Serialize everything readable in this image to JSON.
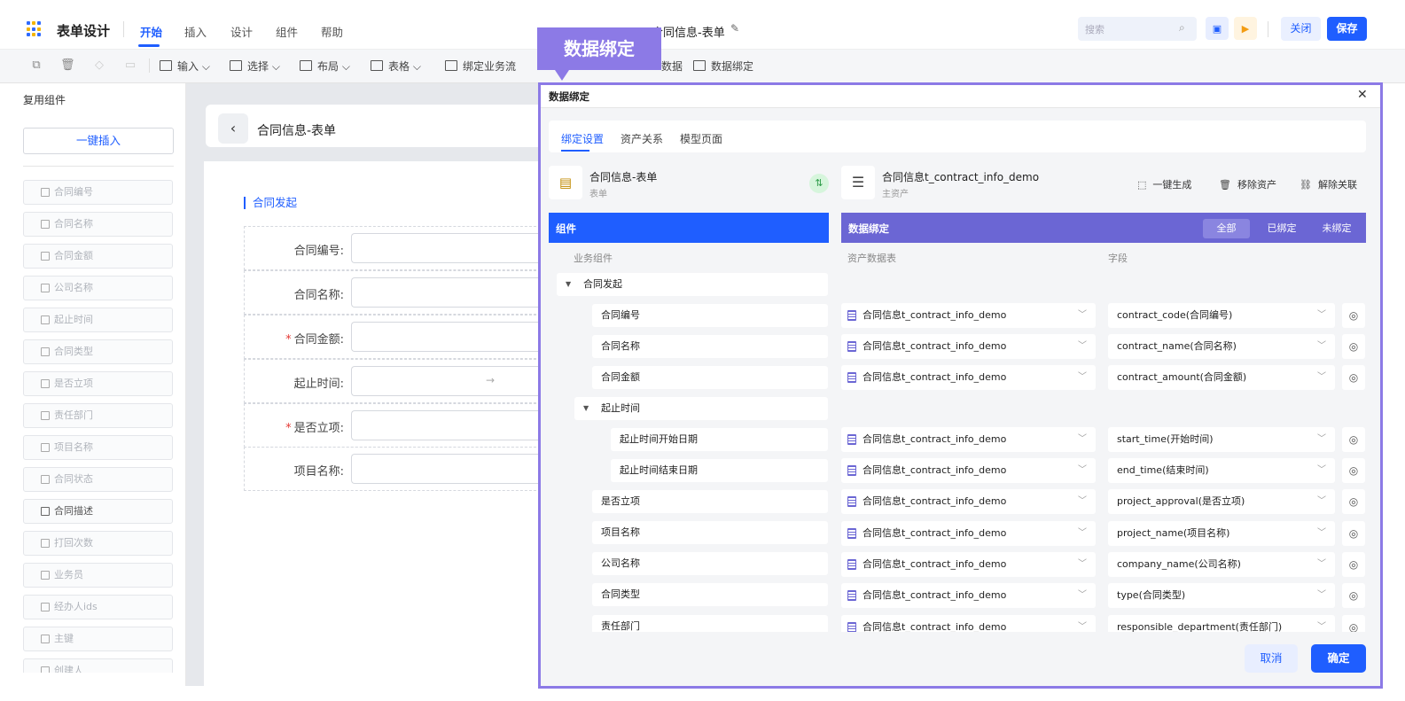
{
  "header": {
    "app_title": "表单设计",
    "menu": [
      "开始",
      "插入",
      "设计",
      "组件",
      "帮助"
    ],
    "doc_title": "合同信息-表单",
    "search_placeholder": "搜索",
    "close_label": "关闭",
    "save_label": "保存"
  },
  "toolbar": {
    "items": [
      "输入",
      "选择",
      "布局",
      "表格",
      "绑定业务流",
      "数据",
      "数据绑定"
    ]
  },
  "left_panel": {
    "title": "复用组件",
    "insert_button": "一键插入",
    "components": [
      "合同编号",
      "合同名称",
      "合同金额",
      "公司名称",
      "起止时间",
      "合同类型",
      "是否立项",
      "责任部门",
      "项目名称",
      "合同状态",
      "合同描述",
      "打回次数",
      "业务员",
      "经办人ids",
      "主键",
      "创建人"
    ]
  },
  "form": {
    "title": "合同信息-表单",
    "section": "合同发起",
    "fields": [
      {
        "label": "合同编号:",
        "required": false
      },
      {
        "label": "合同名称:",
        "required": false
      },
      {
        "label": "合同金额:",
        "required": true
      },
      {
        "label": "起止时间:",
        "required": false
      },
      {
        "label": "是否立项:",
        "required": true
      },
      {
        "label": "项目名称:",
        "required": false
      }
    ],
    "range_arrow": "→"
  },
  "callout": {
    "text": "数据绑定"
  },
  "modal": {
    "title": "数据绑定",
    "tabs": [
      "绑定设置",
      "资产关系",
      "模型页面"
    ],
    "source": {
      "name": "合同信息-表单",
      "type": "表单"
    },
    "target": {
      "name": "合同信息t_contract_info_demo",
      "type": "主资产"
    },
    "actions": [
      "一键生成",
      "移除资产",
      "解除关联"
    ],
    "left_header": "组件",
    "right_header": "数据绑定",
    "filters": [
      "全部",
      "已绑定",
      "未绑定"
    ],
    "col_business": "业务组件",
    "col_table": "资产数据表",
    "col_field": "字段",
    "group": "合同发起",
    "subgroup": "起止时间",
    "rows": [
      {
        "name": "合同编号",
        "table": "合同信息t_contract_info_demo",
        "field": "contract_code(合同编号)"
      },
      {
        "name": "合同名称",
        "table": "合同信息t_contract_info_demo",
        "field": "contract_name(合同名称)"
      },
      {
        "name": "合同金额",
        "table": "合同信息t_contract_info_demo",
        "field": "contract_amount(合同金额)"
      },
      {
        "name": "起止时间开始日期",
        "table": "合同信息t_contract_info_demo",
        "field": "start_time(开始时间)"
      },
      {
        "name": "起止时间结束日期",
        "table": "合同信息t_contract_info_demo",
        "field": "end_time(结束时间)"
      },
      {
        "name": "是否立项",
        "table": "合同信息t_contract_info_demo",
        "field": "project_approval(是否立项)"
      },
      {
        "name": "项目名称",
        "table": "合同信息t_contract_info_demo",
        "field": "project_name(项目名称)"
      },
      {
        "name": "公司名称",
        "table": "合同信息t_contract_info_demo",
        "field": "company_name(公司名称)"
      },
      {
        "name": "合同类型",
        "table": "合同信息t_contract_info_demo",
        "field": "type(合同类型)"
      },
      {
        "name": "责任部门",
        "table": "合同信息t_contract_info_demo",
        "field": "responsible_department(责任部门)"
      }
    ],
    "cancel_label": "取消",
    "ok_label": "确定"
  }
}
